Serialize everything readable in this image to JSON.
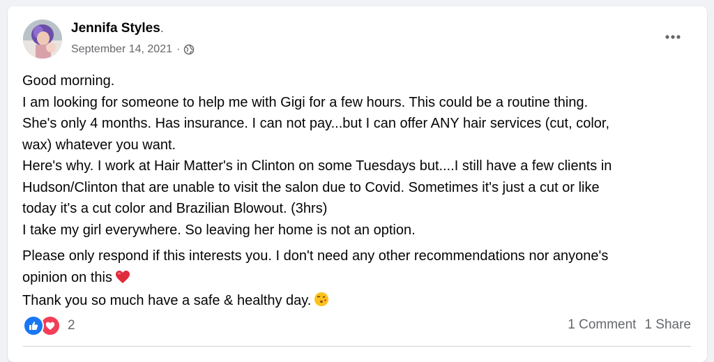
{
  "post": {
    "author": "Jennifa Styles",
    "author_suffix": ".",
    "date": "September 14, 2021",
    "separator": "·",
    "audience_icon": "globe-icon",
    "menu_icon": "more-options-icon",
    "avatar_icon": "profile-photo",
    "body": {
      "line1": "Good morning.",
      "line2": "I am looking for someone to help me with Gigi for a few hours. This could be a routine thing.",
      "line3": "She's only 4 months. Has insurance. I can not pay...but I can offer ANY hair services (cut, color,",
      "line4": "wax) whatever you want.",
      "line5": "Here's why. I work at Hair Matter's in Clinton on some Tuesdays but....I still have a few clients in",
      "line6": "Hudson/Clinton that are unable to visit the salon due to Covid. Sometimes it's just a cut or like",
      "line7": "today it's a cut color and Brazilian Blowout. (3hrs)",
      "line8": "I take my girl everywhere. So leaving her home is not an option.",
      "line9": "Please only respond if this interests you. I don't need any other recommendations nor anyone's",
      "line10": "opinion on this",
      "line11": "Thank you so much have a safe & healthy day."
    },
    "emojis": {
      "heart": "red-heart-emoji",
      "kiss": "face-blowing-kiss-emoji"
    },
    "reactions": {
      "icons": [
        "like-reaction-icon",
        "love-reaction-icon"
      ],
      "count": "2"
    },
    "stats": {
      "comments": "1 Comment",
      "shares": "1 Share"
    },
    "colors": {
      "like_blue": "#1877f2",
      "love_red": "#f33e58",
      "secondary_text": "#65676b",
      "background": "#f0f2f5"
    }
  }
}
